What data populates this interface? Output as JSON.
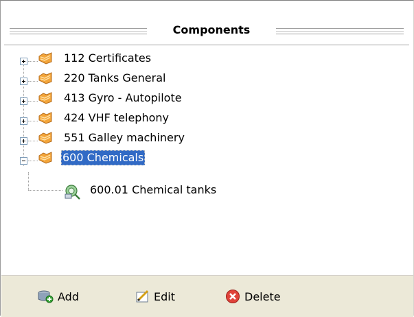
{
  "panel": {
    "title": "Components"
  },
  "tree": {
    "items": [
      {
        "label": "112  Certificates",
        "expanded": false
      },
      {
        "label": "220  Tanks General",
        "expanded": false
      },
      {
        "label": "413  Gyro - Autopilote",
        "expanded": false
      },
      {
        "label": "424  VHF telephony",
        "expanded": false
      },
      {
        "label": "551  Galley machinery",
        "expanded": false
      },
      {
        "label": "600  Chemicals",
        "expanded": true,
        "selected": true
      }
    ],
    "children": [
      {
        "label": "600.01  Chemical tanks"
      }
    ]
  },
  "toolbar": {
    "add_label": "Add",
    "edit_label": "Edit",
    "delete_label": "Delete"
  },
  "colors": {
    "selection": "#316ac5",
    "toolbar_bg": "#ece9d8",
    "folder": "#f3a53a"
  },
  "icons": {
    "folder": "folder-icon",
    "component": "component-icon",
    "add": "add-icon",
    "edit": "edit-icon",
    "delete": "delete-icon"
  }
}
